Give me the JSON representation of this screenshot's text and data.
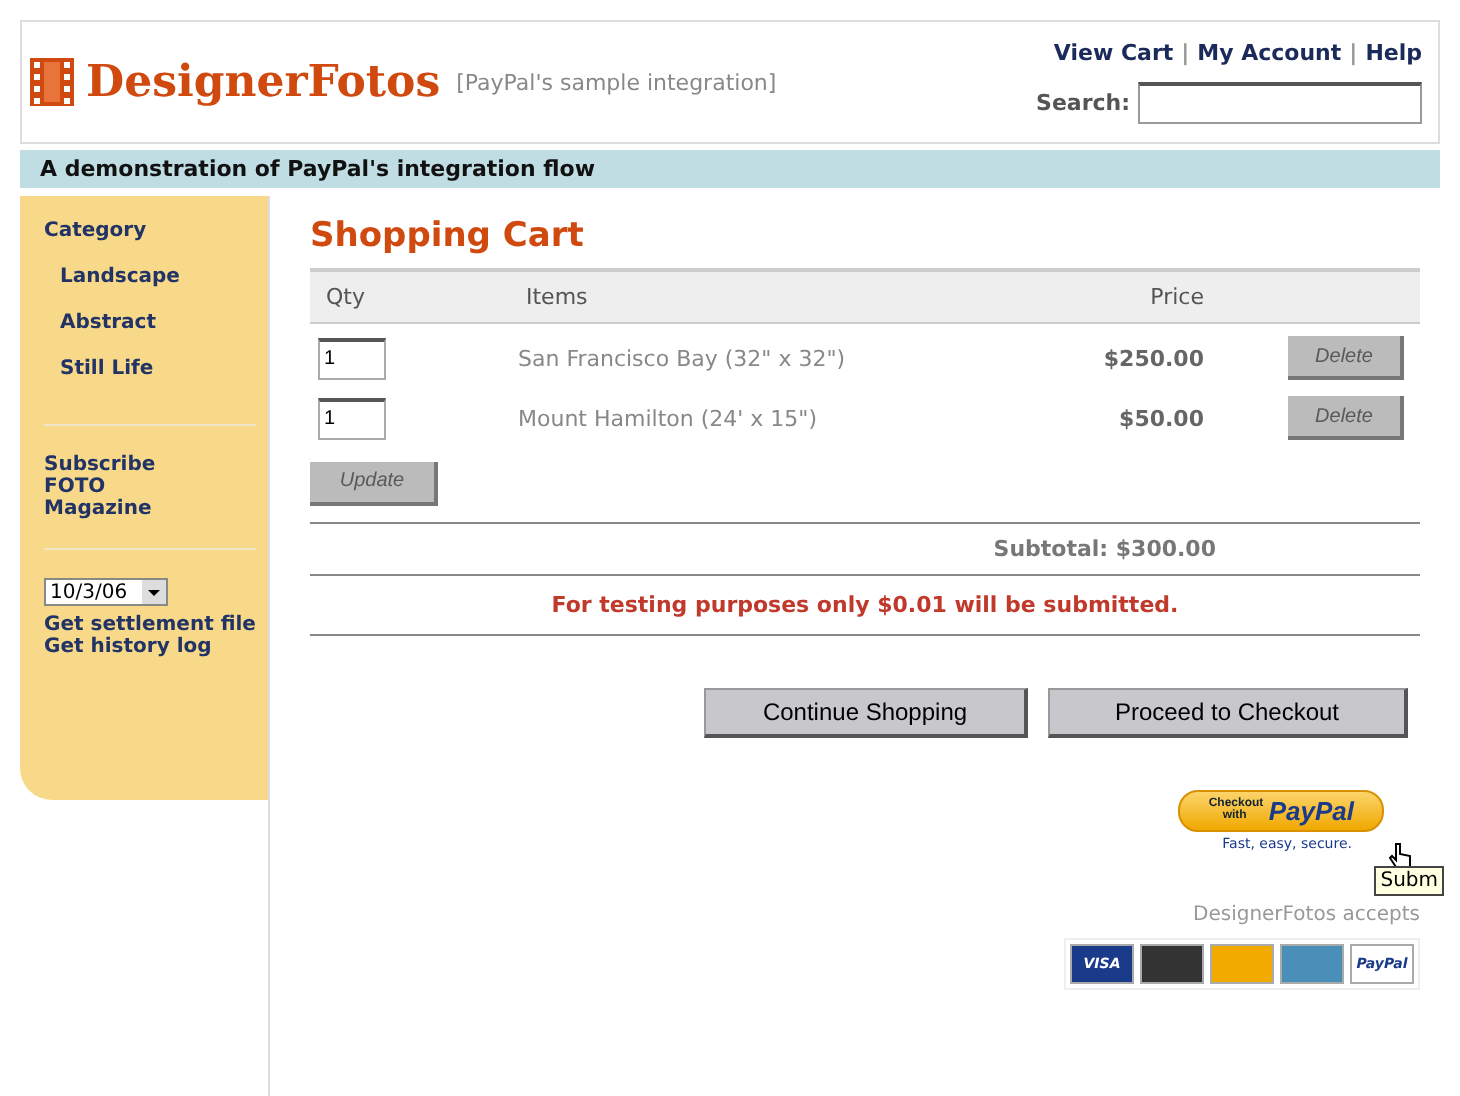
{
  "header": {
    "logo": "DesignerFotos",
    "tagline": "[PayPal's sample integration]",
    "links": [
      "View Cart",
      "My Account",
      "Help"
    ],
    "separator": "|",
    "search": {
      "label": "Search:"
    }
  },
  "banner": "A demonstration of PayPal's integration flow",
  "sidebar": {
    "heading": "Category",
    "categories": [
      "Landscape",
      "Abstract",
      "Still Life"
    ],
    "subscribe": "Subscribe FOTO Magazine",
    "date_select": "10/3/06",
    "links": [
      "Get settlement file",
      "Get history log"
    ]
  },
  "cart": {
    "title": "Shopping Cart",
    "columns": [
      "Qty",
      "Items",
      "Price"
    ],
    "rows": [
      {
        "qty": "1",
        "item": "San Francisco Bay (32\" x 32\")",
        "price": "$250.00",
        "delete": {
          "label": "Delete",
          "disabled": true
        }
      },
      {
        "qty": "1",
        "item": "Mount Hamilton (24' x 15\")",
        "price": "$50.00",
        "delete": {
          "label": "Delete",
          "disabled": true
        }
      }
    ],
    "update": {
      "label": "Update",
      "disabled": true
    },
    "subtotal": "Subtotal: $300.00",
    "notice": "For testing purposes only $0.01 will be submitted.",
    "buttons": [
      "Continue Shopping",
      "Proceed to Checkout"
    ]
  },
  "paypal": {
    "button_small": "Checkout with",
    "button_brand": "PayPal",
    "tagline": "Fast, easy, secure.",
    "tooltip": "Subm"
  },
  "accepts": {
    "label": "DesignerFotos accepts",
    "cards": [
      {
        "kind": "visa",
        "label": "VISA"
      },
      {
        "kind": "discover"
      },
      {
        "kind": "mastercard"
      },
      {
        "kind": "amex"
      },
      {
        "kind": "paypal",
        "label": "PayPal"
      }
    ]
  }
}
